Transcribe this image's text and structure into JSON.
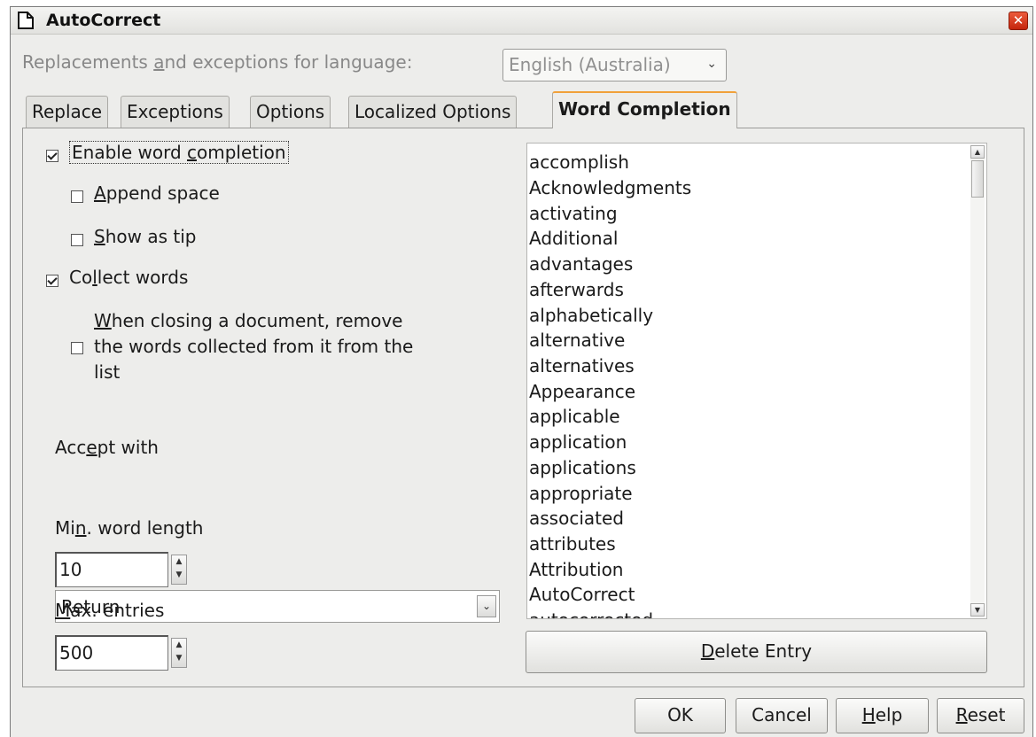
{
  "window": {
    "title": "AutoCorrect",
    "close_glyph": "✕"
  },
  "language": {
    "label": "Replacements and exceptions for language:",
    "label_pre": "Replacements ",
    "label_accel": "a",
    "label_post": "nd exceptions for language:",
    "value": "English (Australia)"
  },
  "tabs": [
    {
      "label": "Replace"
    },
    {
      "label": "Exceptions"
    },
    {
      "label": "Options"
    },
    {
      "label": "Localized Options"
    },
    {
      "label": "Word Completion",
      "active": true
    }
  ],
  "options": {
    "enable": {
      "pre": "Enable word ",
      "accel": "c",
      "post": "ompletion",
      "checked": true
    },
    "append": {
      "pre": "",
      "accel": "A",
      "post": "ppend space",
      "checked": false
    },
    "tip": {
      "pre": "",
      "accel": "S",
      "post": "how as tip",
      "checked": false
    },
    "collect": {
      "pre": "Co",
      "accel": "l",
      "post": "lect words",
      "checked": true
    },
    "remove": {
      "line1_accel": "W",
      "line1_post": "hen closing a document, remove",
      "line2": "the words collected from it from the",
      "line3": "list",
      "checked": false
    }
  },
  "accept": {
    "label_pre": "Acc",
    "label_accel": "e",
    "label_post": "pt with",
    "value": "Return"
  },
  "min_length": {
    "label_pre": "Mi",
    "label_accel": "n",
    "label_post": ". word length",
    "value": "10"
  },
  "max_entries": {
    "label_pre": "",
    "label_accel": "M",
    "label_post": "ax. entries",
    "value": "500"
  },
  "word_list": [
    "accomplish",
    "Acknowledgments",
    "activating",
    "Additional",
    "advantages",
    "afterwards",
    "alphabetically",
    "alternative",
    "alternatives",
    "Appearance",
    "applicable",
    "application",
    "applications",
    "appropriate",
    "associated",
    "attributes",
    "Attribution",
    "AutoCorrect",
    "autocorrected"
  ],
  "buttons": {
    "delete": {
      "accel": "D",
      "post": "elete Entry"
    },
    "ok": "OK",
    "cancel": "Cancel",
    "help": {
      "accel": "H",
      "post": "elp"
    },
    "reset": {
      "accel": "R",
      "post": "eset"
    }
  },
  "icons": {
    "app": "document-icon",
    "close": "close-icon",
    "dropdown": "chevron-down-icon",
    "spin_up": "triangle-up-icon",
    "spin_down": "triangle-down-icon"
  }
}
